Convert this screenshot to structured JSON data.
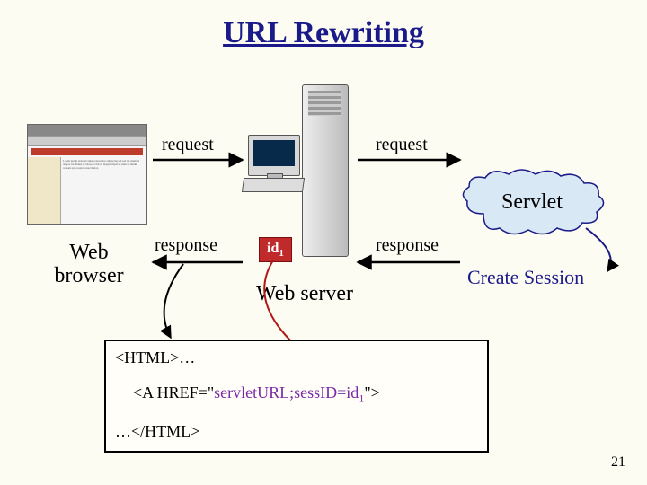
{
  "title": "URL Rewriting",
  "browser_label_l1": "Web",
  "browser_label_l2": "browser",
  "server_label": "Web server",
  "servlet_label": "Servlet",
  "create_session": "Create Session",
  "labels": {
    "request": "request",
    "response": "response"
  },
  "id_badge": {
    "prefix": "id",
    "sub": "1"
  },
  "code": {
    "l1": "<HTML>…",
    "l2_pre": "<A HREF=\"",
    "l2_mid": "servletURL;sessID=id",
    "l2_sub": "1",
    "l2_post": "\">",
    "l3": "…</HTML>"
  },
  "page_number": "21"
}
